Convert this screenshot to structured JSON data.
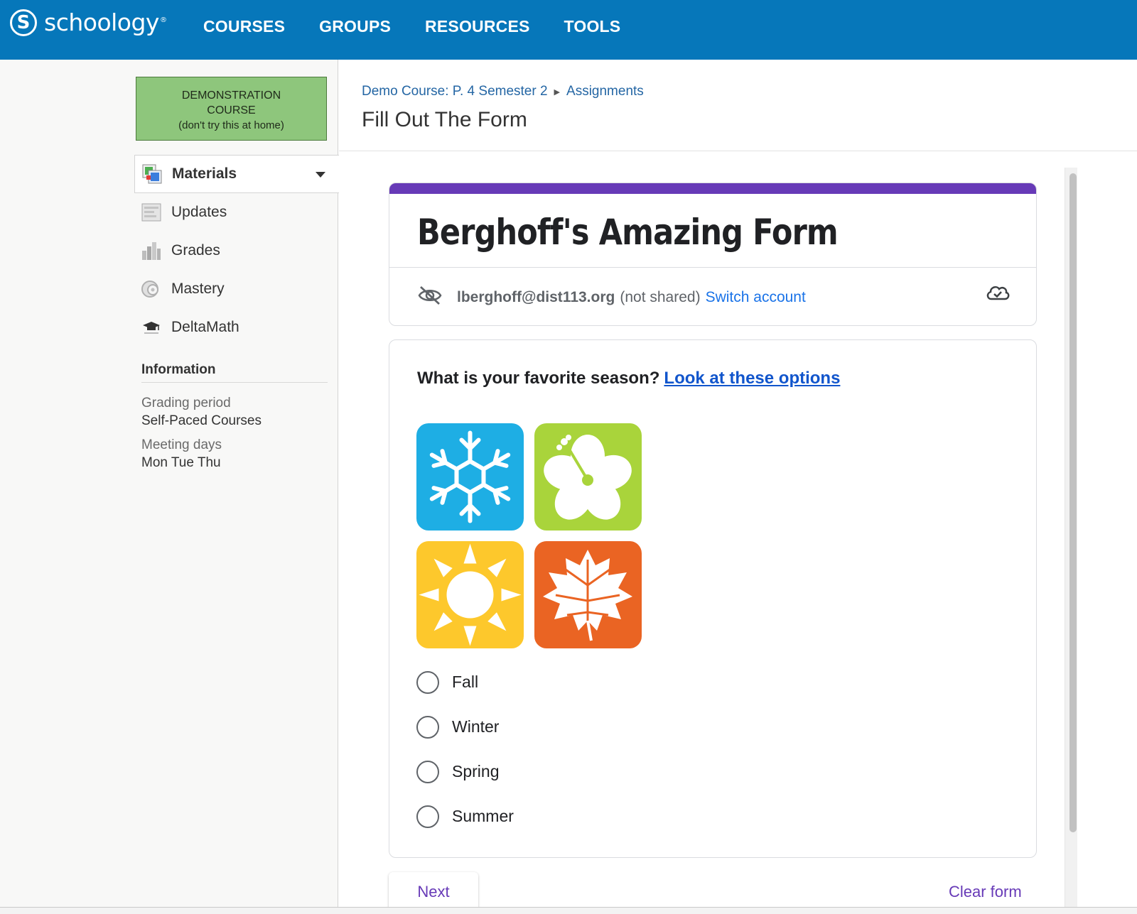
{
  "topbar": {
    "logo_mark": "S",
    "logo_text": "schoology",
    "logo_reg": "®",
    "nav": [
      "COURSES",
      "GROUPS",
      "RESOURCES",
      "TOOLS"
    ]
  },
  "sidebar": {
    "demo_box": {
      "line1": "DEMONSTRATION",
      "line2": "COURSE",
      "line3": "(don't try this at home)"
    },
    "menu": [
      {
        "label": "Materials",
        "icon": "materials-icon",
        "active": true
      },
      {
        "label": "Updates",
        "icon": "updates-icon"
      },
      {
        "label": "Grades",
        "icon": "grades-icon"
      },
      {
        "label": "Mastery",
        "icon": "mastery-icon"
      },
      {
        "label": "DeltaMath",
        "icon": "deltamath-icon"
      }
    ],
    "info": {
      "title": "Information",
      "grading_period_label": "Grading period",
      "grading_period_value": "Self-Paced Courses",
      "meeting_days_label": "Meeting days",
      "meeting_days_value": "Mon Tue Thu"
    }
  },
  "header": {
    "breadcrumb_course": "Demo Course: P. 4 Semester 2",
    "breadcrumb_section": "Assignments",
    "title": "Fill Out The Form"
  },
  "form": {
    "title": "Berghoff's Amazing Form",
    "account_email": "lberghoff@dist113.org",
    "not_shared": "(not shared)",
    "switch_account": "Switch account",
    "question": "What is your favorite season?",
    "question_link": "Look at these options",
    "options": [
      "Fall",
      "Winter",
      "Spring",
      "Summer"
    ],
    "next": "Next",
    "clear": "Clear form"
  },
  "colors": {
    "topbar": "#0677ba",
    "form_accent": "#673ab7",
    "link": "#1a73e8",
    "winter_tile": "#1eaee4",
    "spring_tile": "#a9d43b",
    "summer_tile": "#fdc82c",
    "fall_tile": "#ea6423"
  }
}
